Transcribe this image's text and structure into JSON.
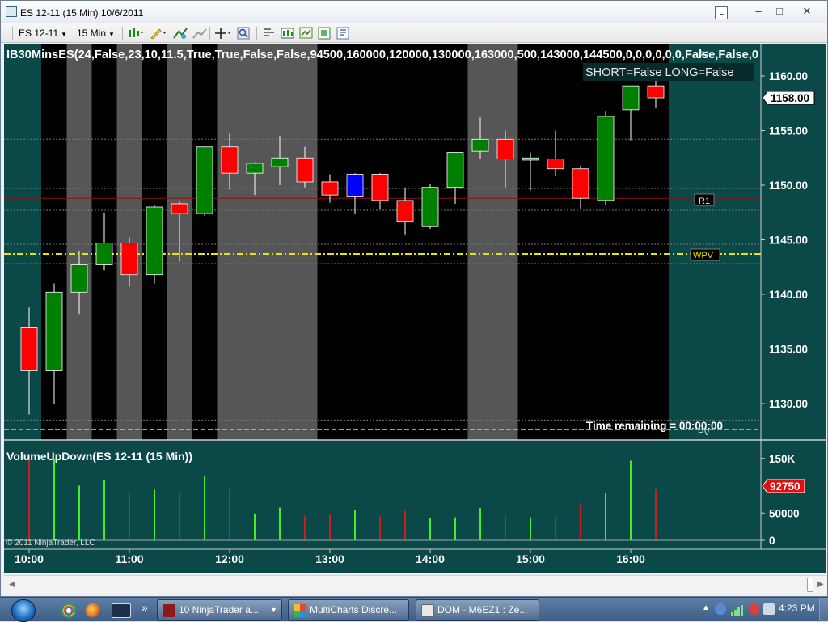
{
  "window": {
    "title": "ES 12-11 (15 Min)  10/6/2011",
    "link_button_label": "L",
    "buttons": {
      "minimize": "–",
      "restore": "□",
      "close": "✕"
    }
  },
  "toolbar": {
    "instrument": "ES 12-11",
    "interval": "15 Min",
    "icons": [
      "bar-style-icon",
      "drawing-tool-icon",
      "add-indicator-icon",
      "strategies-icon",
      "crosshair-icon",
      "zoom-icon",
      "chart-properties-icon",
      "data-box-icon",
      "chart-trader-icon",
      "export-icon",
      "templates-icon"
    ]
  },
  "chart": {
    "indicator_header": "IB30MinsES(24,False,23,10,11.5,True,True,False,False,94500,160000,120000,130000,163000,500,143000,144500,0,0,0,0,0,0,False,False,0",
    "status_box": "SHORT=False LONG=False",
    "r2_label": "R2",
    "r1_label": "R1",
    "wpv_label": "WPV",
    "pv_label": "PV",
    "time_remaining": "Time remaining = 00:00:00",
    "last_price": "1158.00",
    "volume_panel_title": "VolumeUpDown(ES 12-11 (15 Min))",
    "volume_last": "92750",
    "copyright": "© 2011 NinjaTrader, LLC",
    "colors": {
      "up": "#008000",
      "down": "#ff0000",
      "neutral": "#0000ff",
      "vol_up": "#44ee22",
      "vol_down": "#cc1e1e",
      "background": "#000000",
      "outside_session": "#0b4848",
      "band": "#565656",
      "wpv": "#e6e600"
    }
  },
  "chart_data": {
    "type": "candlestick",
    "x_tick_labels": [
      "10:00",
      "11:00",
      "12:00",
      "13:00",
      "14:00",
      "15:00",
      "16:00"
    ],
    "price_axis": {
      "ticks": [
        "1160.00",
        "1155.00",
        "1150.00",
        "1145.00",
        "1140.00",
        "1135.00",
        "1130.00"
      ],
      "range": [
        1127,
        1162.5
      ]
    },
    "volume_axis": {
      "ticks": [
        "150K",
        "50000",
        "0"
      ],
      "range": [
        0,
        165000
      ]
    },
    "levels": {
      "R1": 1148.8,
      "WPV": 1143.7,
      "PV": 1127.6,
      "upper_dotted": 1149.7,
      "lower_dotted": 1147.7,
      "top_dotted": 1154.2
    },
    "candles": [
      {
        "time": "10:00",
        "open": 1137.0,
        "high": 1138.8,
        "low": 1129.0,
        "close": 1133.0
      },
      {
        "time": "10:15",
        "open": 1133.0,
        "high": 1141.0,
        "low": 1130.0,
        "close": 1140.2
      },
      {
        "time": "10:30",
        "open": 1140.2,
        "high": 1144.0,
        "low": 1138.2,
        "close": 1142.7
      },
      {
        "time": "10:45",
        "open": 1142.7,
        "high": 1147.5,
        "low": 1142.2,
        "close": 1144.7
      },
      {
        "time": "11:00",
        "open": 1144.7,
        "high": 1145.2,
        "low": 1140.7,
        "close": 1141.8
      },
      {
        "time": "11:15",
        "open": 1141.8,
        "high": 1148.2,
        "low": 1141.0,
        "close": 1148.0
      },
      {
        "time": "11:30",
        "open": 1148.3,
        "high": 1148.5,
        "low": 1143.0,
        "close": 1147.4
      },
      {
        "time": "11:45",
        "open": 1147.4,
        "high": 1153.6,
        "low": 1147.2,
        "close": 1153.5
      },
      {
        "time": "12:00",
        "open": 1153.5,
        "high": 1154.8,
        "low": 1149.6,
        "close": 1151.1
      },
      {
        "time": "12:15",
        "open": 1151.1,
        "high": 1152.1,
        "low": 1149.1,
        "close": 1152.0
      },
      {
        "time": "12:30",
        "open": 1151.7,
        "high": 1154.5,
        "low": 1150.0,
        "close": 1152.5
      },
      {
        "time": "12:45",
        "open": 1152.5,
        "high": 1153.5,
        "low": 1149.8,
        "close": 1150.3
      },
      {
        "time": "13:00",
        "open": 1150.3,
        "high": 1151.0,
        "low": 1148.4,
        "close": 1149.1
      },
      {
        "time": "13:15",
        "open": 1151.0,
        "high": 1151.1,
        "low": 1147.4,
        "close": 1149.0,
        "color": "neutral"
      },
      {
        "time": "13:30",
        "open": 1151.0,
        "high": 1151.1,
        "low": 1147.8,
        "close": 1148.6
      },
      {
        "time": "13:45",
        "open": 1148.6,
        "high": 1149.8,
        "low": 1145.5,
        "close": 1146.7
      },
      {
        "time": "14:00",
        "open": 1146.2,
        "high": 1150.1,
        "low": 1146.0,
        "close": 1149.8
      },
      {
        "time": "14:15",
        "open": 1149.8,
        "high": 1153.0,
        "low": 1148.3,
        "close": 1153.0
      },
      {
        "time": "14:30",
        "open": 1153.1,
        "high": 1156.2,
        "low": 1152.4,
        "close": 1154.2
      },
      {
        "time": "14:45",
        "open": 1154.2,
        "high": 1155.0,
        "low": 1149.8,
        "close": 1152.4
      },
      {
        "time": "15:00",
        "open": 1152.3,
        "high": 1153.0,
        "low": 1149.5,
        "close": 1152.5
      },
      {
        "time": "15:15",
        "open": 1152.4,
        "high": 1155.0,
        "low": 1150.8,
        "close": 1151.5
      },
      {
        "time": "15:30",
        "open": 1151.5,
        "high": 1151.8,
        "low": 1147.8,
        "close": 1148.8
      },
      {
        "time": "15:45",
        "open": 1148.6,
        "high": 1156.8,
        "low": 1148.2,
        "close": 1156.3
      },
      {
        "time": "16:00",
        "open": 1156.9,
        "high": 1159.0,
        "low": 1154.1,
        "close": 1159.1
      },
      {
        "time": "16:15",
        "open": 1159.1,
        "high": 1159.9,
        "low": 1157.1,
        "close": 1158.0
      }
    ],
    "volume": [
      {
        "time": "10:00",
        "value": 155000,
        "dir": "down"
      },
      {
        "time": "10:15",
        "value": 150000,
        "dir": "up"
      },
      {
        "time": "10:30",
        "value": 100000,
        "dir": "up"
      },
      {
        "time": "10:45",
        "value": 110000,
        "dir": "up"
      },
      {
        "time": "11:00",
        "value": 88000,
        "dir": "down"
      },
      {
        "time": "11:15",
        "value": 93000,
        "dir": "up"
      },
      {
        "time": "11:30",
        "value": 88000,
        "dir": "down"
      },
      {
        "time": "11:45",
        "value": 117000,
        "dir": "up"
      },
      {
        "time": "12:00",
        "value": 94000,
        "dir": "down"
      },
      {
        "time": "12:15",
        "value": 49000,
        "dir": "up"
      },
      {
        "time": "12:30",
        "value": 60000,
        "dir": "up"
      },
      {
        "time": "12:45",
        "value": 45000,
        "dir": "down"
      },
      {
        "time": "13:00",
        "value": 48000,
        "dir": "down"
      },
      {
        "time": "13:15",
        "value": 56000,
        "dir": "up"
      },
      {
        "time": "13:30",
        "value": 44000,
        "dir": "down"
      },
      {
        "time": "13:45",
        "value": 54000,
        "dir": "down"
      },
      {
        "time": "14:00",
        "value": 40000,
        "dir": "up"
      },
      {
        "time": "14:15",
        "value": 42000,
        "dir": "up"
      },
      {
        "time": "14:30",
        "value": 59000,
        "dir": "up"
      },
      {
        "time": "14:45",
        "value": 45000,
        "dir": "down"
      },
      {
        "time": "15:00",
        "value": 42000,
        "dir": "up"
      },
      {
        "time": "15:15",
        "value": 44000,
        "dir": "down"
      },
      {
        "time": "15:30",
        "value": 68000,
        "dir": "down"
      },
      {
        "time": "15:45",
        "value": 87000,
        "dir": "up"
      },
      {
        "time": "16:00",
        "value": 146000,
        "dir": "up"
      },
      {
        "time": "16:15",
        "value": 92750,
        "dir": "down"
      }
    ]
  },
  "taskbar": {
    "tasks": [
      {
        "label": "10 NinjaTrader a...",
        "icon": "ninjatrader-icon"
      },
      {
        "label": "MultiCharts Discre...",
        "icon": "multicharts-icon"
      },
      {
        "label": "DOM - M6EZ1 : Ze...",
        "icon": "dom-icon"
      }
    ],
    "overflow_glyph": "»",
    "clock": "4:23 PM"
  },
  "scrollbar": {
    "left_arrow": "◀",
    "right_arrow": "▶"
  }
}
